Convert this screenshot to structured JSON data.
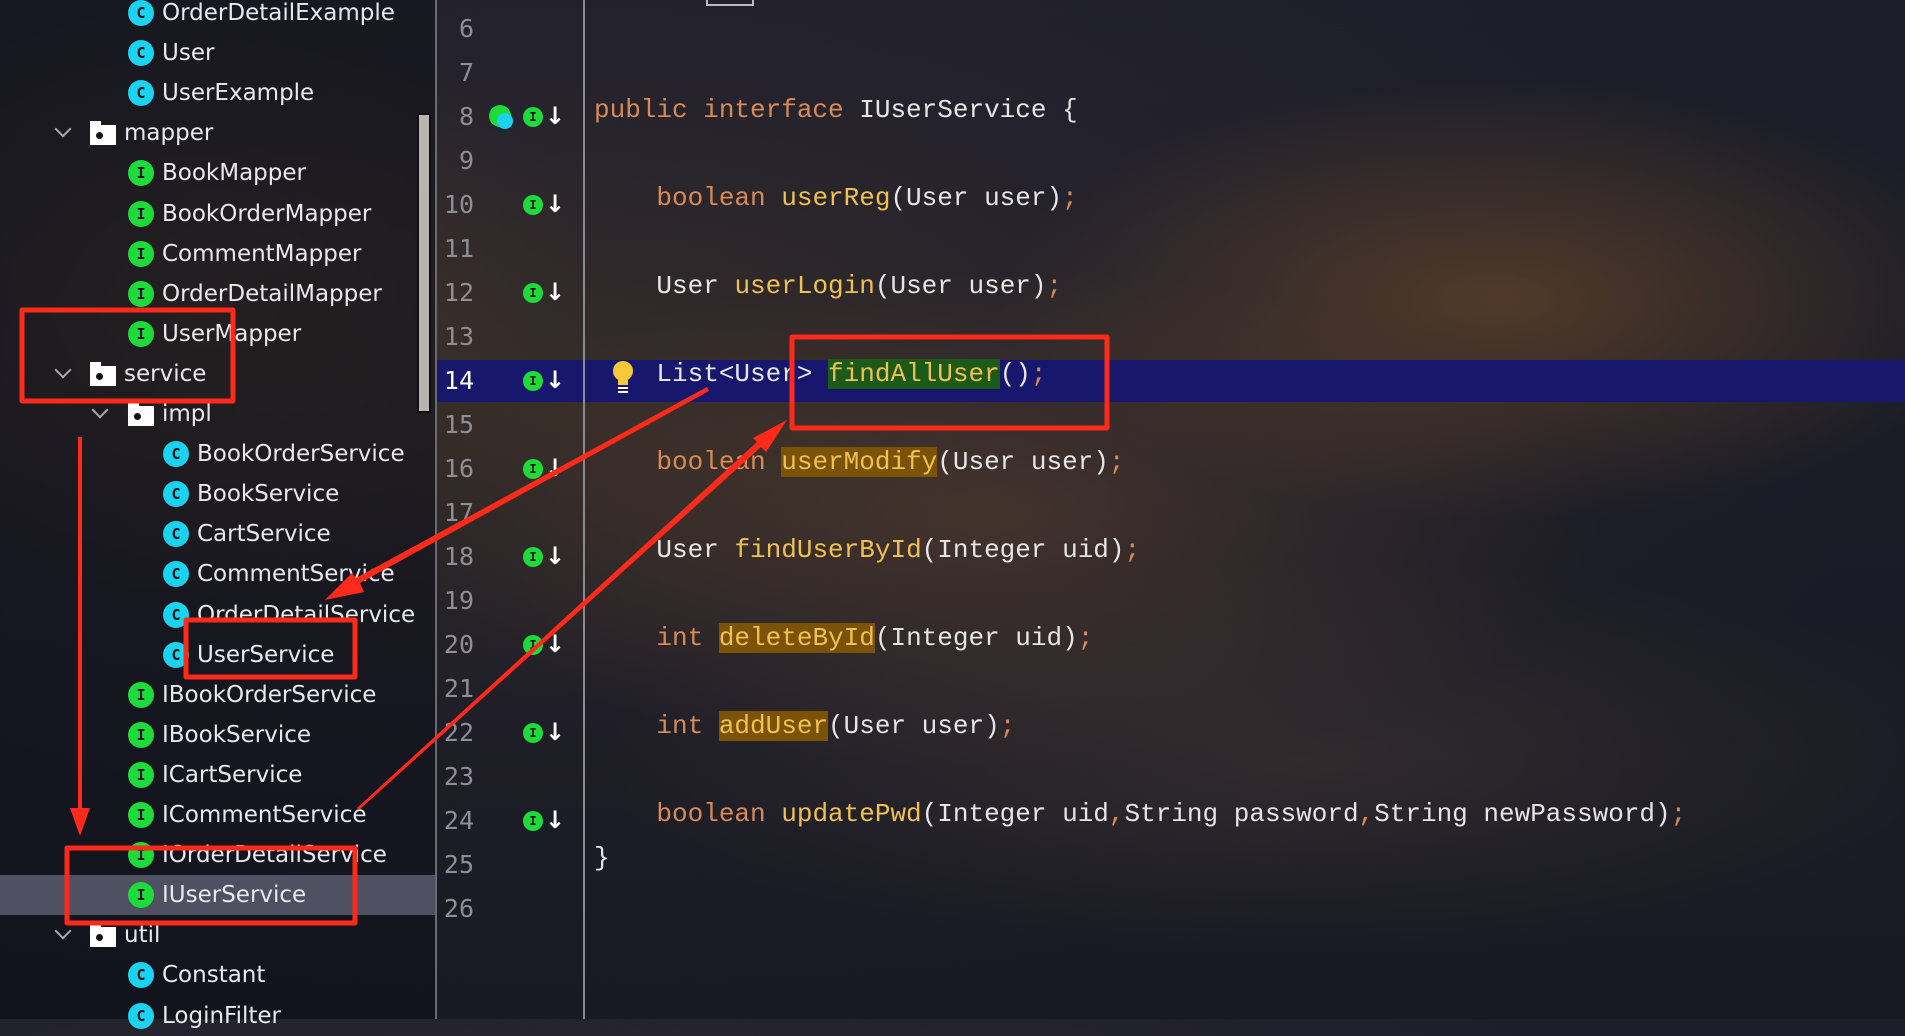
{
  "project_tree": {
    "items": [
      {
        "label": "OrderDetailExample",
        "icon": "class-icon",
        "level": 2
      },
      {
        "label": "User",
        "icon": "class-icon",
        "level": 2
      },
      {
        "label": "UserExample",
        "icon": "class-icon",
        "level": 2
      },
      {
        "label": "mapper",
        "icon": "package-folder-icon",
        "level": 1,
        "expanded": true
      },
      {
        "label": "BookMapper",
        "icon": "interface-icon",
        "level": 2
      },
      {
        "label": "BookOrderMapper",
        "icon": "interface-icon",
        "level": 2
      },
      {
        "label": "CommentMapper",
        "icon": "interface-icon",
        "level": 2
      },
      {
        "label": "OrderDetailMapper",
        "icon": "interface-icon",
        "level": 2
      },
      {
        "label": "UserMapper",
        "icon": "interface-icon",
        "level": 2
      },
      {
        "label": "service",
        "icon": "package-folder-icon",
        "level": 1,
        "expanded": true
      },
      {
        "label": "impl",
        "icon": "package-folder-icon",
        "level": 2,
        "expanded": true
      },
      {
        "label": "BookOrderService",
        "icon": "class-icon",
        "level": 3
      },
      {
        "label": "BookService",
        "icon": "class-icon",
        "level": 3
      },
      {
        "label": "CartService",
        "icon": "class-icon",
        "level": 3
      },
      {
        "label": "CommentService",
        "icon": "class-icon",
        "level": 3
      },
      {
        "label": "OrderDetailService",
        "icon": "class-icon",
        "level": 3
      },
      {
        "label": "UserService",
        "icon": "class-icon",
        "level": 3
      },
      {
        "label": "IBookOrderService",
        "icon": "interface-icon",
        "level": 2
      },
      {
        "label": "IBookService",
        "icon": "interface-icon",
        "level": 2
      },
      {
        "label": "ICartService",
        "icon": "interface-icon",
        "level": 2
      },
      {
        "label": "ICommentService",
        "icon": "interface-icon",
        "level": 2
      },
      {
        "label": "IOrderDetailService",
        "icon": "interface-icon",
        "level": 2
      },
      {
        "label": "IUserService",
        "icon": "interface-icon",
        "level": 2,
        "selected": true
      },
      {
        "label": "util",
        "icon": "package-folder-icon",
        "level": 1,
        "expanded": true
      },
      {
        "label": "Constant",
        "icon": "class-icon",
        "level": 2
      },
      {
        "label": "LoginFilter",
        "icon": "class-icon",
        "level": 2
      }
    ]
  },
  "editor": {
    "current_line": 14,
    "lines": [
      {
        "n": "6",
        "tokens": []
      },
      {
        "n": "7",
        "tokens": []
      },
      {
        "n": "8",
        "gutter": "implemented-interface-icon",
        "tokens": [
          {
            "t": "public ",
            "c": "k"
          },
          {
            "t": "interface ",
            "c": "k"
          },
          {
            "t": "IUserService {",
            "c": "p"
          }
        ]
      },
      {
        "n": "9",
        "tokens": []
      },
      {
        "n": "10",
        "gutter": "implemented-icon",
        "tokens": [
          {
            "t": "    boolean ",
            "c": "k"
          },
          {
            "t": "userReg",
            "c": "m"
          },
          {
            "t": "(User user)",
            "c": "p"
          },
          {
            "t": ";",
            "c": "s"
          }
        ]
      },
      {
        "n": "11",
        "tokens": []
      },
      {
        "n": "12",
        "gutter": "implemented-icon",
        "tokens": [
          {
            "t": "    User ",
            "c": "p"
          },
          {
            "t": "userLogin",
            "c": "m"
          },
          {
            "t": "(User user)",
            "c": "p"
          },
          {
            "t": ";",
            "c": "s"
          }
        ]
      },
      {
        "n": "13",
        "tokens": []
      },
      {
        "n": "14",
        "gutter": "implemented-icon",
        "tokens": [
          {
            "t": "    List<User> ",
            "c": "p"
          },
          {
            "t": "findAllUser",
            "c": "m bg"
          },
          {
            "t": "()",
            "c": "p"
          },
          {
            "t": ";",
            "c": "s"
          }
        ]
      },
      {
        "n": "15",
        "tokens": []
      },
      {
        "n": "16",
        "gutter": "implemented-icon",
        "tokens": [
          {
            "t": "    boolean ",
            "c": "k"
          },
          {
            "t": "userModify",
            "c": "m bm"
          },
          {
            "t": "(User user)",
            "c": "p"
          },
          {
            "t": ";",
            "c": "s"
          }
        ]
      },
      {
        "n": "17",
        "tokens": []
      },
      {
        "n": "18",
        "gutter": "implemented-icon",
        "tokens": [
          {
            "t": "    User ",
            "c": "p"
          },
          {
            "t": "findUserById",
            "c": "m"
          },
          {
            "t": "(Integer uid)",
            "c": "p"
          },
          {
            "t": ";",
            "c": "s"
          }
        ]
      },
      {
        "n": "19",
        "tokens": []
      },
      {
        "n": "20",
        "gutter": "implemented-icon",
        "tokens": [
          {
            "t": "    int ",
            "c": "k"
          },
          {
            "t": "deleteById",
            "c": "m bm"
          },
          {
            "t": "(Integer uid)",
            "c": "p"
          },
          {
            "t": ";",
            "c": "s"
          }
        ]
      },
      {
        "n": "21",
        "tokens": []
      },
      {
        "n": "22",
        "gutter": "implemented-icon",
        "tokens": [
          {
            "t": "    int ",
            "c": "k"
          },
          {
            "t": "addUser",
            "c": "m bm"
          },
          {
            "t": "(User user)",
            "c": "p"
          },
          {
            "t": ";",
            "c": "s"
          }
        ]
      },
      {
        "n": "23",
        "tokens": []
      },
      {
        "n": "24",
        "gutter": "implemented-icon",
        "tokens": [
          {
            "t": "    boolean ",
            "c": "k"
          },
          {
            "t": "updatePwd",
            "c": "m"
          },
          {
            "t": "(Integer uid",
            "c": "p"
          },
          {
            "t": ",",
            "c": "s"
          },
          {
            "t": "String password",
            "c": "p"
          },
          {
            "t": ",",
            "c": "s"
          },
          {
            "t": "String newPassword)",
            "c": "p"
          },
          {
            "t": ";",
            "c": "s"
          }
        ]
      },
      {
        "n": "25",
        "tokens": [
          {
            "t": "}",
            "c": "p"
          }
        ]
      },
      {
        "n": "26",
        "tokens": []
      }
    ]
  },
  "colors": {
    "annotation": "#ff2a1a",
    "current_line": "#17176e",
    "keyword": "#d98a55",
    "method": "#f0c050",
    "class_icon": "#19d3f0",
    "interface_icon": "#1ddc3a"
  },
  "icons": {
    "class": "C",
    "interface": "I"
  }
}
